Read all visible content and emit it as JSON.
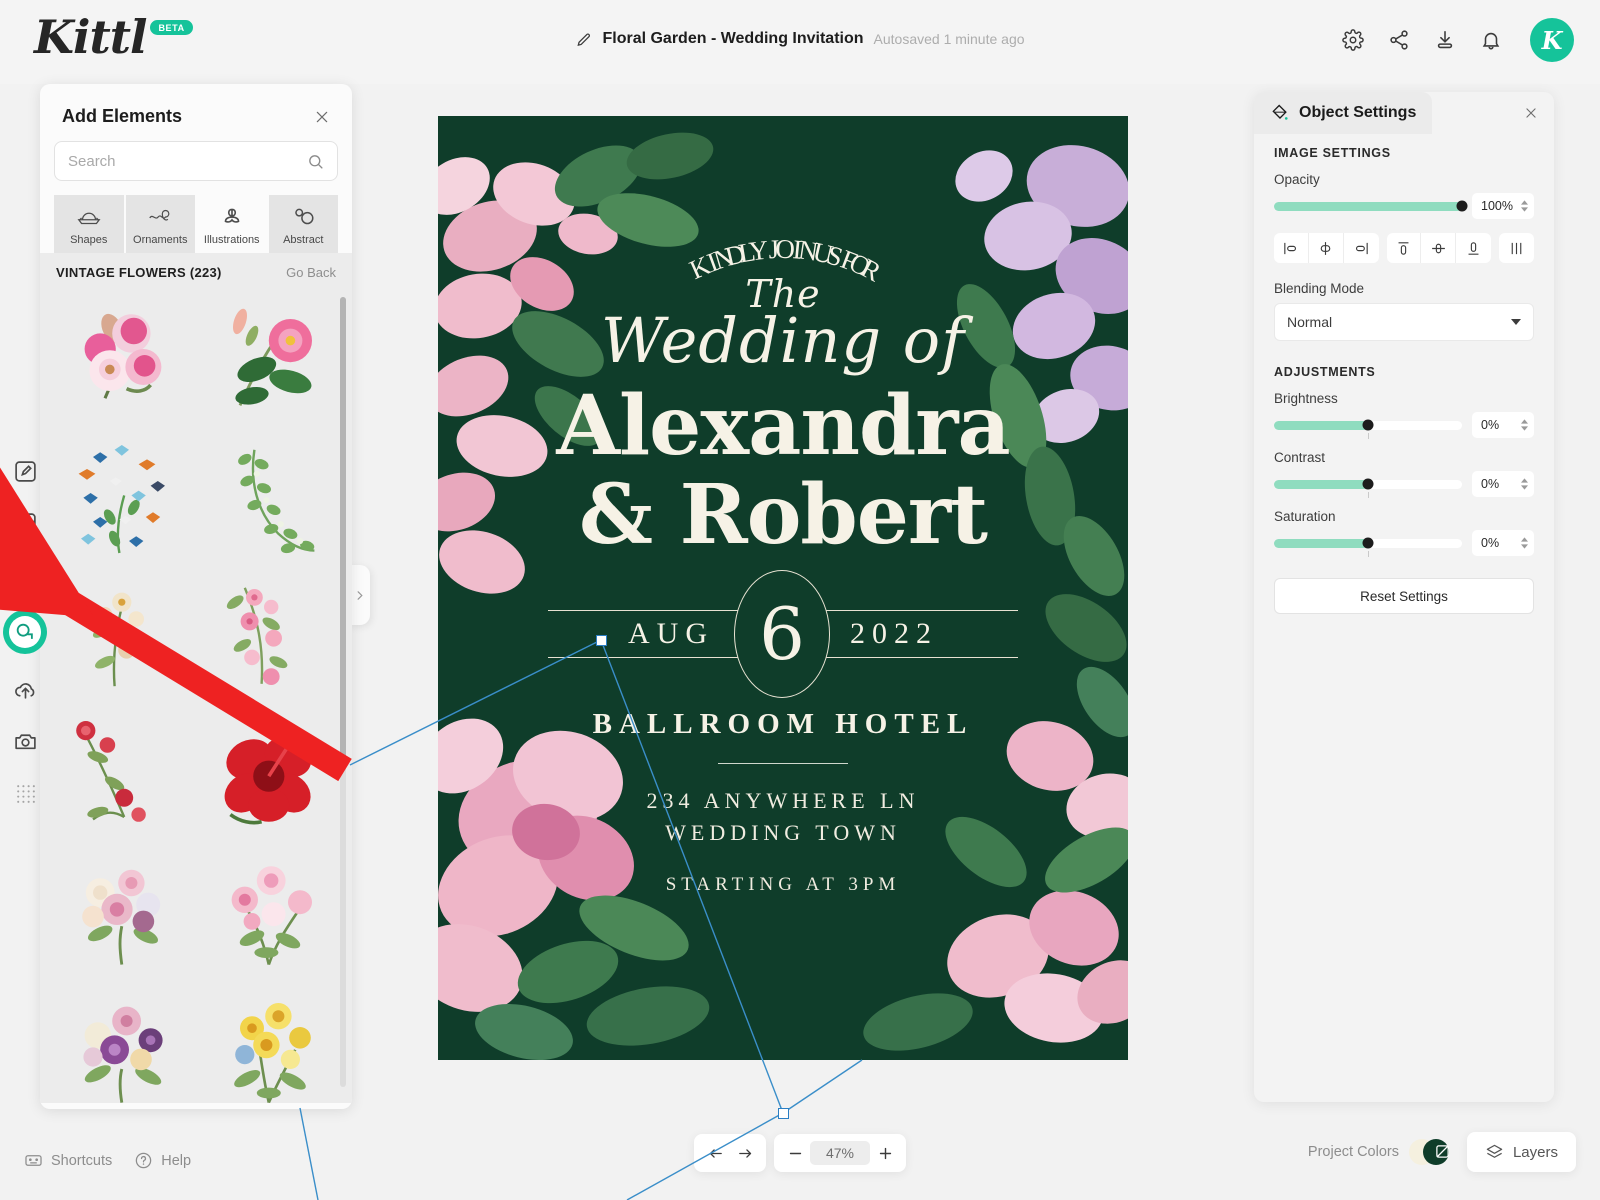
{
  "header": {
    "logo": "Kittl",
    "beta": "BETA",
    "doc_title": "Floral Garden - Wedding Invitation",
    "autosave": "Autosaved 1 minute ago",
    "pencil_icon": "pencil-icon",
    "actions": [
      {
        "name": "settings-gear-icon",
        "label": "Settings"
      },
      {
        "name": "share-icon",
        "label": "Share"
      },
      {
        "name": "download-icon",
        "label": "Download"
      },
      {
        "name": "notifications-bell-icon",
        "label": "Notifications"
      }
    ],
    "avatar_initial": "K"
  },
  "left_rail": [
    {
      "name": "design-edit-icon",
      "label": "Edit"
    },
    {
      "name": "templates-icon",
      "label": "Templates"
    },
    {
      "name": "text-icon",
      "label": "Text"
    },
    {
      "name": "elements-icon",
      "label": "Elements",
      "active": true
    },
    {
      "name": "upload-icon",
      "label": "Uploads"
    },
    {
      "name": "photos-camera-icon",
      "label": "Photos"
    },
    {
      "name": "grid-dots-icon",
      "label": "More"
    }
  ],
  "left_panel": {
    "title": "Add Elements",
    "close_icon": "close-icon",
    "search": {
      "value": "",
      "placeholder": "Search",
      "icon": "search-icon"
    },
    "tabs": [
      {
        "label": "Shapes",
        "icon": "shapes-icon",
        "selected": false
      },
      {
        "label": "Ornaments",
        "icon": "ornaments-icon",
        "selected": false
      },
      {
        "label": "Illustrations",
        "icon": "illustrations-flower-icon",
        "selected": true
      },
      {
        "label": "Abstract",
        "icon": "abstract-icon",
        "selected": false
      }
    ],
    "group_title": "VINTAGE FLOWERS (223)",
    "go_back": "Go Back",
    "elements": [
      {
        "name": "pink-magnolia-bouquet"
      },
      {
        "name": "pink-hibiscus-branch"
      },
      {
        "name": "butterfly-collection"
      },
      {
        "name": "green-ivy-vine"
      },
      {
        "name": "wild-rose-sprig"
      },
      {
        "name": "pink-blossom-branch"
      },
      {
        "name": "red-rosebud-stem"
      },
      {
        "name": "red-hibiscus-bloom"
      },
      {
        "name": "pastel-rose-posy"
      },
      {
        "name": "pink-rose-spray"
      },
      {
        "name": "mixed-purple-bouquet"
      },
      {
        "name": "yellow-wildflower-bunch"
      }
    ]
  },
  "canvas": {
    "collapse_icon": "chevron-right-icon",
    "design": {
      "kindly": "KINDLY JOIN US FOR",
      "the": "The",
      "wedding_of": "Wedding of",
      "name_line1": "Alexandra",
      "name_line2": "& Robert",
      "month": "AUG",
      "day": "6",
      "year": "2022",
      "venue": "BALLROOM HOTEL",
      "address_line1": "234 ANYWHERE LN",
      "address_line2": "WEDDING TOWN",
      "time": "STARTING AT 3PM",
      "bg_color": "#0f3d2a",
      "text_color": "#f6f2e6"
    }
  },
  "right_panel": {
    "title": "Object Settings",
    "tab_icon": "object-settings-icon",
    "close_icon": "close-icon",
    "image_settings_label": "IMAGE SETTINGS",
    "opacity": {
      "label": "Opacity",
      "value": "100%",
      "percent": 100
    },
    "align_buttons": [
      {
        "name": "align-left-icon",
        "label": "Align left"
      },
      {
        "name": "align-center-horizontal-icon",
        "label": "Align center"
      },
      {
        "name": "align-right-icon",
        "label": "Align right"
      },
      {
        "name": "align-top-icon",
        "label": "Align top"
      },
      {
        "name": "align-middle-vertical-icon",
        "label": "Align middle"
      },
      {
        "name": "align-bottom-icon",
        "label": "Align bottom"
      },
      {
        "name": "distribute-icon",
        "label": "Distribute"
      }
    ],
    "blending": {
      "label": "Blending Mode",
      "value": "Normal"
    },
    "adjustments_label": "ADJUSTMENTS",
    "adjustments": [
      {
        "label": "Brightness",
        "value": "0%",
        "percent": 50
      },
      {
        "label": "Contrast",
        "value": "0%",
        "percent": 50
      },
      {
        "label": "Saturation",
        "value": "0%",
        "percent": 50
      }
    ],
    "reset_label": "Reset Settings"
  },
  "footer": {
    "shortcuts": {
      "label": "Shortcuts",
      "icon": "keyboard-icon"
    },
    "help": {
      "label": "Help",
      "icon": "help-circle-icon"
    },
    "undo_icon": "undo-arrow-icon",
    "redo_icon": "redo-arrow-icon",
    "zoom_out_icon": "minus-icon",
    "zoom_in_icon": "plus-icon",
    "zoom_level": "47%",
    "project_colors": {
      "label": "Project Colors",
      "colors": [
        "#f5f0df",
        "#0f3d2a"
      ]
    },
    "layers": {
      "label": "Layers",
      "icon": "layers-icon"
    }
  },
  "accent": {
    "teal": "#15c39a",
    "selection_blue": "#2b7fc4",
    "annotation_red": "#ee2222"
  }
}
